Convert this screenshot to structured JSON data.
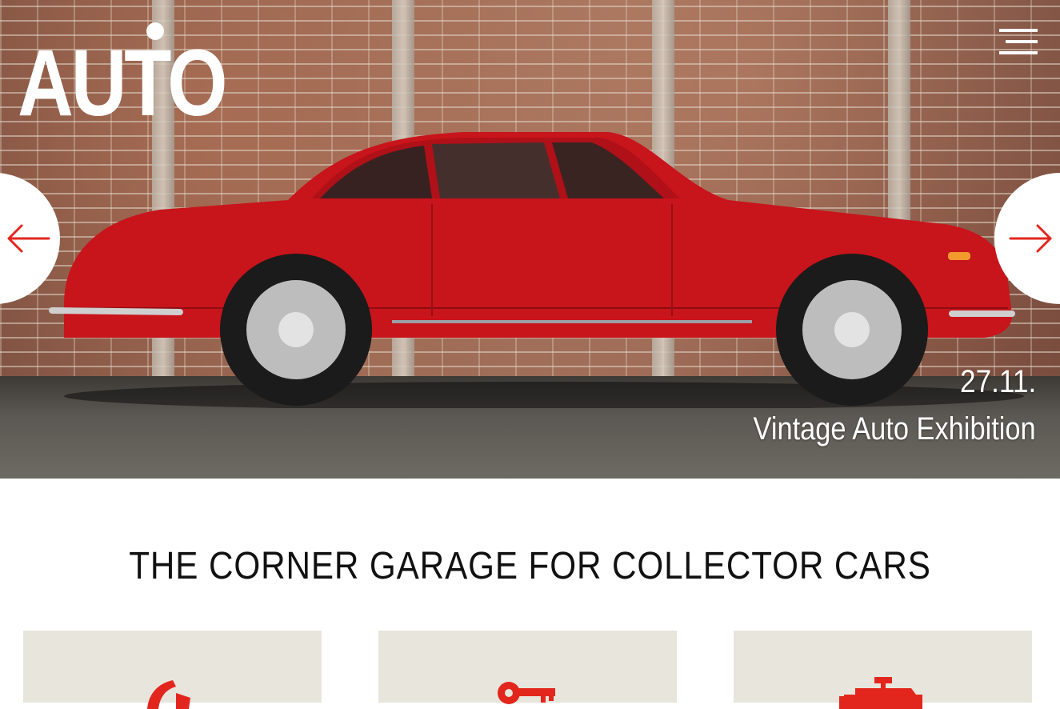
{
  "header": {
    "logo_text": "AUTO",
    "menu_icon": "hamburger-icon"
  },
  "hero": {
    "slide_date": "27.11.",
    "slide_title": "Vintage Auto Exhibition",
    "prev_icon": "arrow-left-icon",
    "next_icon": "arrow-right-icon",
    "accent_color": "#e3261d",
    "car_color": "#c8141b"
  },
  "main": {
    "heading": "THE CORNER GARAGE FOR COLLECTOR CARS",
    "cards": [
      {
        "icon": "horn-icon"
      },
      {
        "icon": "key-icon"
      },
      {
        "icon": "engine-icon"
      }
    ]
  }
}
